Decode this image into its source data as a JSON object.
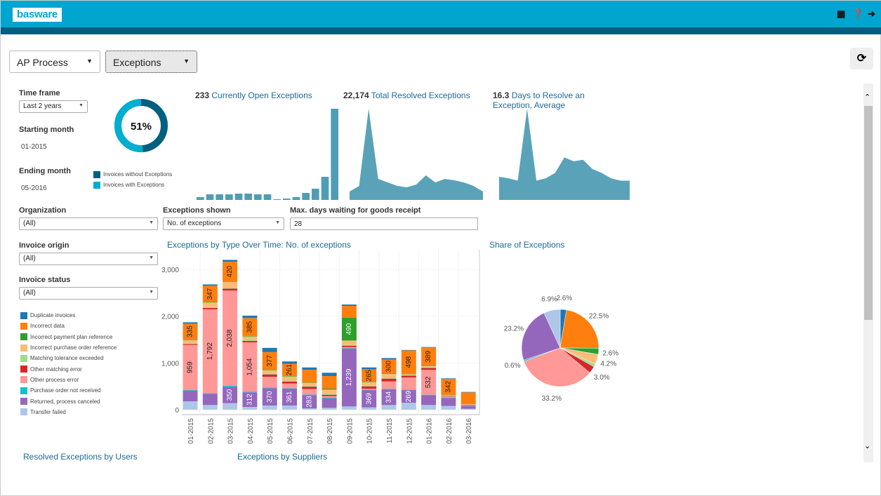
{
  "header": {
    "logo": "basware",
    "icons": [
      "film-icon",
      "help-icon",
      "logout-icon"
    ]
  },
  "toolbar": {
    "process": "AP Process",
    "view": "Exceptions",
    "refresh_icon": "refresh-icon"
  },
  "filters": {
    "time_frame_label": "Time frame",
    "time_frame": "Last 2 years",
    "start_label": "Starting month",
    "start": "01-2015",
    "end_label": "Ending month",
    "end": "05-2016",
    "org_label": "Organization",
    "org": "(All)",
    "origin_label": "Invoice origin",
    "origin": "(All)",
    "status_label": "Invoice status",
    "status": "(All)",
    "exc_shown_label": "Exceptions shown",
    "exc_shown": "No. of exceptions",
    "max_days_label": "Max. days waiting for goods receipt",
    "max_days": "28"
  },
  "donut": {
    "value_pct": 51,
    "label": "51%",
    "legend": [
      "Invoices without Exceptions",
      "Invoices with Exceptions"
    ],
    "colors": [
      "#00607f",
      "#00aecf"
    ]
  },
  "kpis": [
    {
      "value": "233",
      "label": "Currently Open Exceptions",
      "spark": [
        4,
        8,
        8,
        8,
        9,
        9,
        8,
        8,
        1,
        2,
        4,
        10,
        16,
        33,
        130
      ]
    },
    {
      "value": "22,174",
      "label": "Total Resolved Exceptions",
      "spark": [
        12,
        20,
        130,
        30,
        25,
        20,
        18,
        22,
        35,
        25,
        30,
        28,
        25,
        20,
        12
      ]
    },
    {
      "value": "16.3",
      "label": "Days to Resolve an Exception, Average",
      "spark": [
        30,
        28,
        25,
        118,
        25,
        28,
        35,
        55,
        50,
        52,
        40,
        35,
        28,
        25,
        25
      ]
    }
  ],
  "chart_data": [
    {
      "type": "bar",
      "stacked": true,
      "title": "Exceptions by Type Over Time: No. of exceptions",
      "ylim": [
        0,
        3300
      ],
      "yticks": [
        "0",
        "1,000",
        "2,000",
        "3,000"
      ],
      "grid": true,
      "categories": [
        "01-2015",
        "02-2015",
        "03-2015",
        "04-2015",
        "05-2015",
        "06-2015",
        "07-2015",
        "08-2015",
        "09-2015",
        "10-2015",
        "11-2015",
        "12-2015",
        "01-2016",
        "02-2016",
        "03-2016"
      ],
      "series": [
        {
          "name": "Transfer failed",
          "color": "#aec7e8",
          "values": [
            180,
            100,
            140,
            60,
            90,
            90,
            30,
            40,
            70,
            50,
            100,
            150,
            100,
            80,
            20
          ],
          "labels": []
        },
        {
          "name": "Returned, process canceled",
          "color": "#9467bd",
          "values": [
            230,
            240,
            350,
            312,
            370,
            361,
            283,
            200,
            1239,
            369,
            334,
            269,
            200,
            170,
            60
          ],
          "labels": [
            "",
            "",
            "350",
            "312",
            "370",
            "361",
            "283",
            "",
            "1,239",
            "369",
            "334",
            "269",
            "",
            "",
            ""
          ]
        },
        {
          "name": "Purchase order not received",
          "color": "#17becf",
          "values": [
            15,
            15,
            20,
            15,
            15,
            10,
            10,
            20,
            10,
            10,
            10,
            10,
            20,
            10,
            5
          ],
          "labels": []
        },
        {
          "name": "Other process error",
          "color": "#ff9896",
          "values": [
            959,
            1792,
            2038,
            1054,
            230,
            100,
            120,
            30,
            20,
            20,
            160,
            260,
            532,
            20,
            10
          ],
          "labels": [
            "959",
            "1,792",
            "2,038",
            "1,054",
            "",
            "",
            "",
            "",
            "",
            "",
            "",
            "",
            "532",
            "",
            ""
          ]
        },
        {
          "name": "Other matching error",
          "color": "#d62728",
          "values": [
            20,
            30,
            40,
            30,
            50,
            40,
            50,
            30,
            30,
            50,
            60,
            40,
            40,
            10,
            10
          ],
          "labels": []
        },
        {
          "name": "Matching tolerance exceeded",
          "color": "#98df8a",
          "values": [
            15,
            15,
            15,
            15,
            20,
            20,
            20,
            20,
            20,
            20,
            20,
            10,
            20,
            10,
            5
          ],
          "labels": []
        },
        {
          "name": "Incorrect purchase order reference",
          "color": "#ffbb78",
          "values": [
            70,
            100,
            130,
            80,
            70,
            90,
            60,
            90,
            90,
            70,
            80,
            20,
            20,
            10,
            10
          ],
          "labels": []
        },
        {
          "name": "Incorrect payment plan reference",
          "color": "#2ca02c",
          "values": [
            15,
            10,
            10,
            10,
            10,
            10,
            10,
            20,
            490,
            10,
            10,
            10,
            10,
            10,
            0
          ],
          "labels": [
            "",
            "",
            "",
            "",
            "",
            "",
            "",
            "",
            "490",
            "",
            "",
            "",
            "",
            "",
            ""
          ]
        },
        {
          "name": "Incorrect data",
          "color": "#ff7f0e",
          "values": [
            335,
            347,
            420,
            385,
            377,
            261,
            270,
            270,
            250,
            265,
            300,
            498,
            389,
            342,
            250
          ],
          "labels": [
            "335",
            "347",
            "420",
            "385",
            "377",
            "261",
            "",
            "",
            "",
            "265",
            "300",
            "498",
            "389",
            "342",
            ""
          ]
        },
        {
          "name": "Duplicate invoices",
          "color": "#1f77b4",
          "values": [
            30,
            30,
            40,
            50,
            90,
            50,
            50,
            70,
            30,
            40,
            30,
            10,
            10,
            10,
            10
          ],
          "labels": []
        }
      ]
    },
    {
      "type": "pie",
      "title": "Share of Exceptions",
      "slices": [
        {
          "name": "Duplicate invoices",
          "value": 2.6,
          "label": "2.6%",
          "color": "#1f77b4"
        },
        {
          "name": "Incorrect data",
          "value": 22.5,
          "label": "22.5%",
          "color": "#ff7f0e"
        },
        {
          "name": "Incorrect payment plan reference",
          "value": 2.6,
          "label": "2.6%",
          "color": "#2ca02c"
        },
        {
          "name": "Incorrect purchase order reference",
          "value": 4.2,
          "label": "4.2%",
          "color": "#ffbb78"
        },
        {
          "name": "Matching tolerance exceeded",
          "value": 1.2,
          "label": "",
          "color": "#98df8a"
        },
        {
          "name": "Other matching error",
          "value": 3.0,
          "label": "3.0%",
          "color": "#d62728"
        },
        {
          "name": "Other process error",
          "value": 33.2,
          "label": "33.2%",
          "color": "#ff9896"
        },
        {
          "name": "Purchase order not received",
          "value": 0.6,
          "label": "0.6%",
          "color": "#17becf"
        },
        {
          "name": "Returned, process canceled",
          "value": 23.2,
          "label": "23.2%",
          "color": "#9467bd"
        },
        {
          "name": "Transfer failed",
          "value": 6.9,
          "label": "6.9%",
          "color": "#aec7e8"
        }
      ]
    }
  ],
  "legend": [
    "Duplicate invoices",
    "Incorrect data",
    "Incorrect payment plan reference",
    "Incorrect purchase order reference",
    "Matching tolerance exceeded",
    "Other matching error",
    "Other process error",
    "Purchase order not received",
    "Returned, process canceled",
    "Transfer failed"
  ],
  "legend_colors": [
    "#1f77b4",
    "#ff7f0e",
    "#2ca02c",
    "#ffbb78",
    "#98df8a",
    "#d62728",
    "#ff9896",
    "#17becf",
    "#9467bd",
    "#aec7e8"
  ],
  "sections": {
    "users": "Resolved Exceptions by Users",
    "suppliers": "Exceptions by Suppliers"
  }
}
